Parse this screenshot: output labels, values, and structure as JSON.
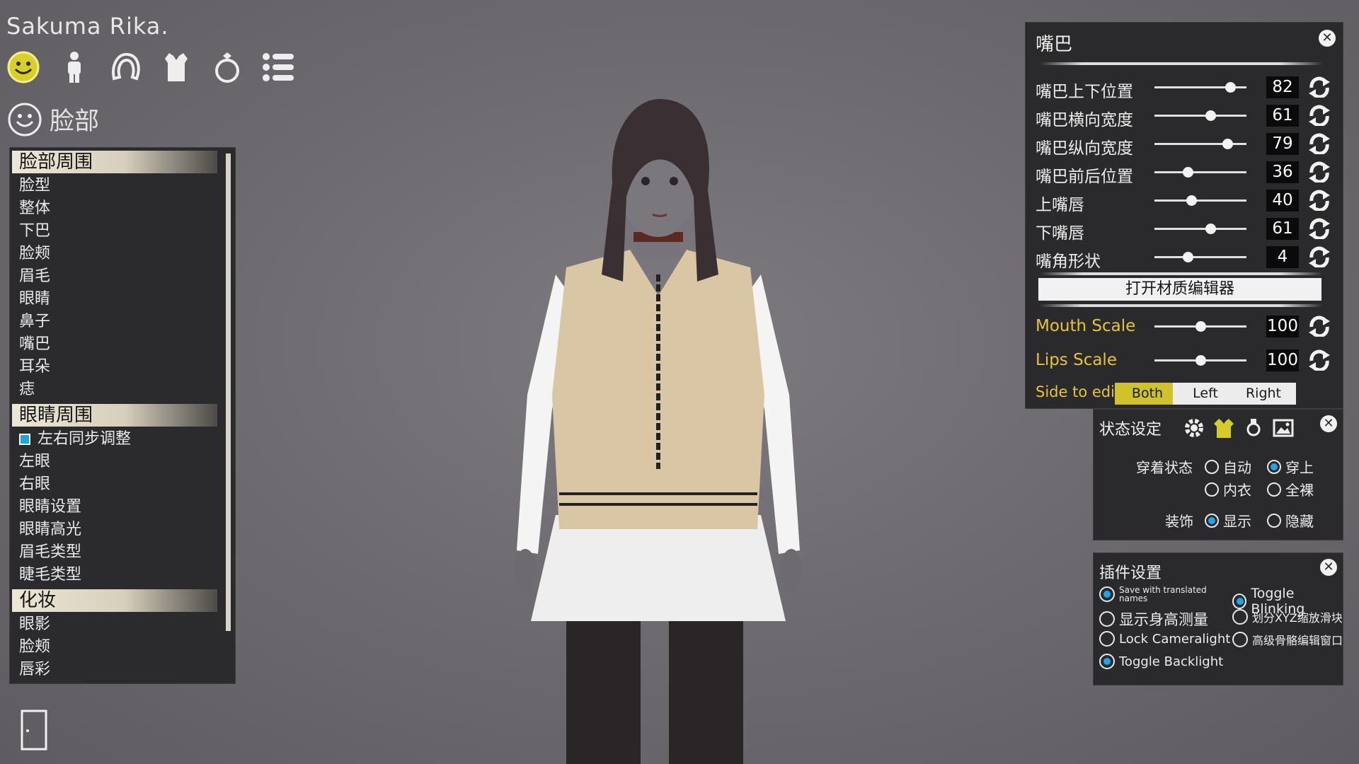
{
  "character": {
    "name": "Sakuma Rika."
  },
  "categories": [
    {
      "name": "face",
      "icon": "smiley-icon",
      "active": true
    },
    {
      "name": "body",
      "icon": "person-icon"
    },
    {
      "name": "hair",
      "icon": "hair-icon"
    },
    {
      "name": "clothes",
      "icon": "shirt-icon"
    },
    {
      "name": "accessories",
      "icon": "ring-icon"
    },
    {
      "name": "more",
      "icon": "list-icon"
    }
  ],
  "section": {
    "title": "脸部"
  },
  "left_menu": {
    "groups": [
      {
        "header": "脸部周围",
        "items": [
          "脸型",
          "整体",
          "下巴",
          "脸颊",
          "眉毛",
          "眼睛",
          "鼻子",
          "嘴巴",
          "耳朵",
          "痣"
        ]
      },
      {
        "header": "眼睛周围",
        "check_item": "左右同步调整",
        "items": [
          "左眼",
          "右眼",
          "眼睛设置",
          "眼睛高光",
          "眉毛类型",
          "睫毛类型"
        ]
      },
      {
        "header": "化妆",
        "items": [
          "眼影",
          "脸颊",
          "唇彩"
        ]
      }
    ]
  },
  "mouth_panel": {
    "title": "嘴巴",
    "sliders": [
      {
        "label": "嘴巴上下位置",
        "value": "82"
      },
      {
        "label": "嘴巴横向宽度",
        "value": "61"
      },
      {
        "label": "嘴巴纵向宽度",
        "value": "79"
      },
      {
        "label": "嘴巴前后位置",
        "value": "36"
      },
      {
        "label": "上嘴唇",
        "value": "40"
      },
      {
        "label": "下嘴唇",
        "value": "61"
      },
      {
        "label": "嘴角形状",
        "value": "4"
      }
    ],
    "material_button": "打开材质编辑器",
    "scale_sliders": [
      {
        "label": "Mouth Scale",
        "value": "100",
        "fraction": 0.5
      },
      {
        "label": "Lips Scale",
        "value": "100",
        "fraction": 0.5
      }
    ],
    "side_label": "Side to edit",
    "side_options": [
      "Both",
      "Left",
      "Right"
    ],
    "side_selected": "Both"
  },
  "state_panel": {
    "title": "状态设定",
    "tools": [
      "gear-icon",
      "clothing-icon",
      "lightbulb-icon",
      "image-icon"
    ],
    "dress_label": "穿着状态",
    "dress_options": [
      "自动",
      "穿上",
      "内衣",
      "全裸"
    ],
    "dress_selected": "穿上",
    "accessory_label": "装饰",
    "accessory_options": [
      "显示",
      "隐藏"
    ],
    "accessory_selected": "显示"
  },
  "plugin_panel": {
    "title": "插件设置",
    "options": [
      {
        "label": "Save with translated names",
        "checked": true
      },
      {
        "label": "Toggle Blinking",
        "checked": true
      },
      {
        "label": "显示身高测量",
        "checked": false
      },
      {
        "label": "划分XYZ缩放滑块",
        "checked": false
      },
      {
        "label": "Lock Cameralight",
        "checked": false
      },
      {
        "label": "高级骨骼编辑窗口",
        "checked": false
      },
      {
        "label": "Toggle Backlight",
        "checked": true
      }
    ]
  },
  "colors": {
    "accent_yellow": "#e6c33c",
    "radio_blue": "#1aa8ea",
    "panel_bg": "#2a2a2c"
  }
}
